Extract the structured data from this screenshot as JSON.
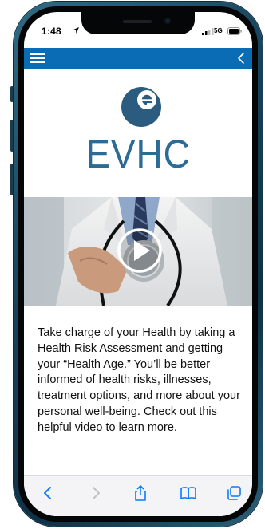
{
  "status_bar": {
    "time": "1:48",
    "network": "5G",
    "location_icon": "location-arrow-icon",
    "signal_icon": "signal-bars-icon",
    "battery_icon": "battery-icon"
  },
  "app_nav": {
    "menu_icon": "hamburger-menu-icon",
    "back_icon": "chevron-left-icon",
    "bar_color": "#0a6cb4"
  },
  "brand": {
    "logo_icon": "evhc-logo-icon",
    "name": "EVHC",
    "color": "#2b6c96"
  },
  "video": {
    "play_icon": "play-icon"
  },
  "description": "Take charge of your Health by taking a Health Risk Assessment and  getting your “Health Age.” You’ll be better informed of health risks, illnesses, treatment options, and more about your personal well-being. Check out this helpful video to learn more.",
  "browser_toolbar": {
    "items": [
      {
        "icon": "back-chevron-icon"
      },
      {
        "icon": "forward-chevron-icon"
      },
      {
        "icon": "share-icon"
      },
      {
        "icon": "bookmarks-icon"
      },
      {
        "icon": "tabs-icon"
      }
    ],
    "accent": "#0a7aff"
  }
}
